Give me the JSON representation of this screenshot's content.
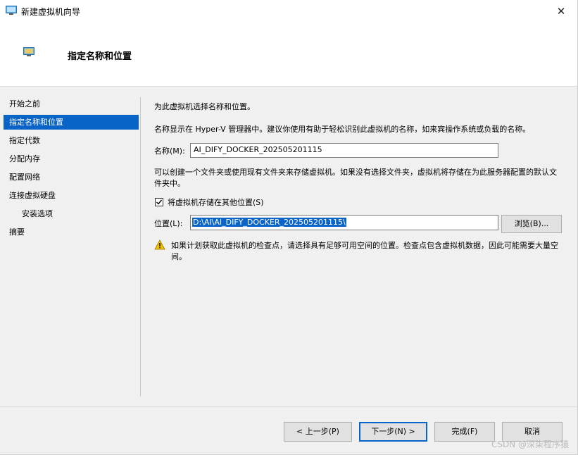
{
  "window": {
    "title": "新建虚拟机向导",
    "close": "✕"
  },
  "header": {
    "title": "指定名称和位置"
  },
  "sidebar": {
    "items": [
      {
        "label": "开始之前"
      },
      {
        "label": "指定名称和位置"
      },
      {
        "label": "指定代数"
      },
      {
        "label": "分配内存"
      },
      {
        "label": "配置网络"
      },
      {
        "label": "连接虚拟硬盘"
      },
      {
        "label": "安装选项"
      },
      {
        "label": "摘要"
      }
    ]
  },
  "main": {
    "intro": "为此虚拟机选择名称和位置。",
    "name_hint": "名称显示在 Hyper-V 管理器中。建议你使用有助于轻松识别此虚拟机的名称，如来宾操作系统或负载的名称。",
    "name_label": "名称(M):",
    "name_value": "AI_DIFY_DOCKER_202505201115",
    "folder_hint_line1": "可以创建一个文件夹或使用现有文件夹来存储虚拟机。如果没有选择文件夹，虚拟机将存储在为此服务器配置的默认文",
    "folder_hint_line2": "件夹中。",
    "store_checkbox_label": "将虚拟机存储在其他位置(S)",
    "location_label": "位置(L):",
    "location_value": "D:\\AI\\AI_DIFY_DOCKER_202505201115\\",
    "browse_button": "浏览(B)...",
    "warning_line1": "如果计划获取此虚拟机的检查点，请选择具有足够可用空间的位置。检查点包含虚拟机数据，因此可能需要大量空",
    "warning_line2": "间。"
  },
  "footer": {
    "prev": "< 上一步(P)",
    "next": "下一步(N) >",
    "finish": "完成(F)",
    "cancel": "取消"
  },
  "watermark": "CSDN @深柒程序猿",
  "colors": {
    "accent": "#0a64c8",
    "warning": "#f2c200"
  }
}
